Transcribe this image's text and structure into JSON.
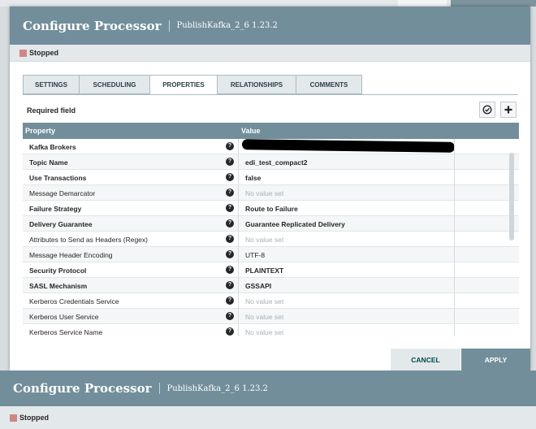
{
  "dialog": {
    "title": "Configure Processor",
    "subtitle": "PublishKafka_2_6 1.23.2",
    "status": "Stopped"
  },
  "tabs": [
    {
      "label": "SETTINGS",
      "active": false
    },
    {
      "label": "SCHEDULING",
      "active": false
    },
    {
      "label": "PROPERTIES",
      "active": true
    },
    {
      "label": "RELATIONSHIPS",
      "active": false
    },
    {
      "label": "COMMENTS",
      "active": false
    }
  ],
  "required_field_label": "Required field",
  "table": {
    "headers": {
      "property": "Property",
      "value": "Value"
    },
    "rows": [
      {
        "name": "Kafka Brokers",
        "required": true,
        "value": "",
        "redacted": true
      },
      {
        "name": "Topic Name",
        "required": true,
        "value": "edi_test_compact2"
      },
      {
        "name": "Use Transactions",
        "required": true,
        "value": "false"
      },
      {
        "name": "Message Demarcator",
        "required": false,
        "value": "No value set",
        "unset": true
      },
      {
        "name": "Failure Strategy",
        "required": true,
        "value": "Route to Failure"
      },
      {
        "name": "Delivery Guarantee",
        "required": true,
        "value": "Guarantee Replicated Delivery"
      },
      {
        "name": "Attributes to Send as Headers (Regex)",
        "required": false,
        "value": "No value set",
        "unset": true
      },
      {
        "name": "Message Header Encoding",
        "required": false,
        "value": "UTF-8"
      },
      {
        "name": "Security Protocol",
        "required": true,
        "value": "PLAINTEXT"
      },
      {
        "name": "SASL Mechanism",
        "required": true,
        "value": "GSSAPI"
      },
      {
        "name": "Kerberos Credentials Service",
        "required": false,
        "value": "No value set",
        "unset": true
      },
      {
        "name": "Kerberos User Service",
        "required": false,
        "value": "No value set",
        "unset": true
      },
      {
        "name": "Kerberos Service Name",
        "required": false,
        "value": "No value set",
        "unset": true
      }
    ]
  },
  "buttons": {
    "cancel": "CANCEL",
    "apply": "APPLY"
  },
  "background": {
    "title": "Configure Processor",
    "subtitle": "PublishKafka_2_6 1.23.2",
    "status": "Stopped"
  },
  "icons": {
    "verify": "check-circle-icon",
    "add": "plus-icon",
    "help": "question-circle-icon"
  }
}
